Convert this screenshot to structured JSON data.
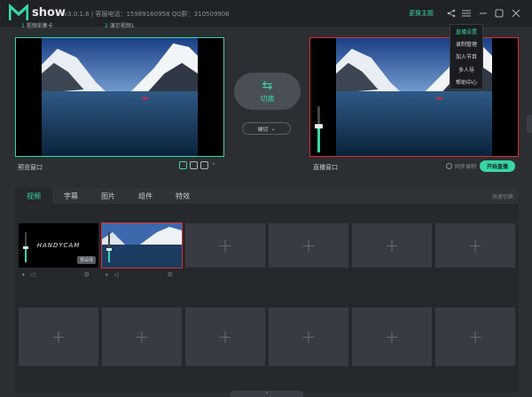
{
  "titlebar": {
    "app_name": "show",
    "info": "v3.0.1.6  |  客服电话：15989160958  QQ群：310509906",
    "theme_link": "更换主题"
  },
  "menu": {
    "items": [
      {
        "label": "直播设置",
        "active": true
      },
      {
        "label": "录制管理",
        "active": false
      },
      {
        "label": "加入节目",
        "active": false
      },
      {
        "label": "多人导",
        "active": false
      },
      {
        "label": "帮助中心",
        "active": false
      }
    ]
  },
  "preview": {
    "label": "预览窗口"
  },
  "live": {
    "label": "直播窗口",
    "sync_label": "同步录制",
    "start_button": "开始直播",
    "volume": 0.55
  },
  "switch": {
    "label": "切换",
    "mode": "硬切"
  },
  "tabs": [
    "视频",
    "字幕",
    "图片",
    "组件",
    "特效"
  ],
  "active_tab": "视频",
  "shortcut_label": "快速切换",
  "sources": [
    {
      "index": "1",
      "title": "视频采集卡",
      "type": "camera",
      "camera_text": "HANDYCAM",
      "badge": "预设场",
      "volume": 0.5
    },
    {
      "index": "2",
      "title": "演示视频1",
      "type": "video",
      "volume": 0.45
    }
  ],
  "colors": {
    "accent": "#39d6a7",
    "live": "#e02d2d"
  }
}
